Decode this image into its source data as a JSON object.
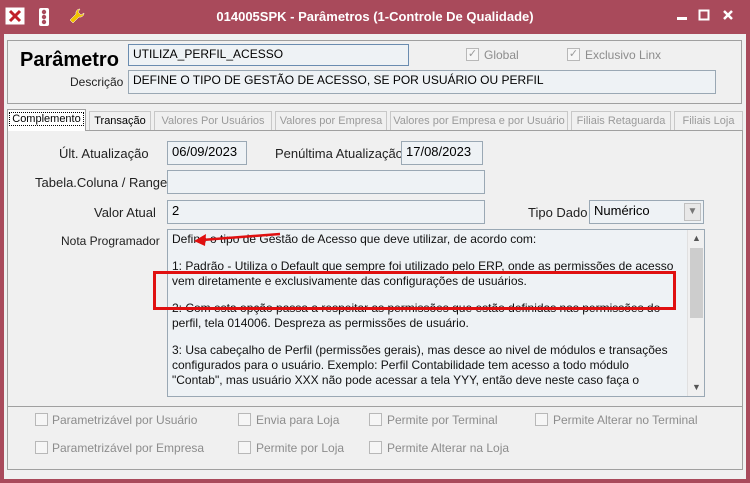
{
  "window": {
    "title": "014005SPK - Parâmetros (1-Controle De Qualidade)",
    "titlebar_color": "#a94a5b",
    "icons": [
      "close-red-icon",
      "traffic-light-icon",
      "wrench-icon"
    ],
    "controls": [
      "minimize-icon",
      "restore-icon",
      "close-icon"
    ]
  },
  "header": {
    "parametro_label": "Parâmetro",
    "parametro_value": "UTILIZA_PERFIL_ACESSO",
    "descricao_label": "Descrição",
    "descricao_value": "DEFINE O TIPO DE GESTÃO DE ACESSO, SE POR USUÁRIO OU PERFIL",
    "global_label": "Global",
    "global_checked": true,
    "exclusivo_label": "Exclusivo Linx",
    "exclusivo_checked": true
  },
  "tabs": [
    {
      "label": "Complemento",
      "state": "active"
    },
    {
      "label": "Transação",
      "state": "enabled"
    },
    {
      "label": "Valores Por Usuários",
      "state": "disabled"
    },
    {
      "label": "Valores por Empresa",
      "state": "disabled"
    },
    {
      "label": "Valores por Empresa e por Usuário",
      "state": "disabled"
    },
    {
      "label": "Filiais Retaguarda",
      "state": "disabled"
    },
    {
      "label": "Filiais Loja",
      "state": "disabled"
    }
  ],
  "form": {
    "ult_atualizacao_label": "Últ. Atualização",
    "ult_atualizacao_value": "06/09/2023",
    "penultima_label": "Penúltima Atualização",
    "penultima_value": "17/08/2023",
    "tabela_label": "Tabela.Coluna / Range",
    "tabela_value": "",
    "valor_atual_label": "Valor Atual",
    "valor_atual_value": "2",
    "tipo_dado_label": "Tipo Dado",
    "tipo_dado_value": "Numérico",
    "nota_label": "Nota Programador",
    "nota_paragraphs": [
      "Define o tipo de Gestão de Acesso que deve utilizar, de acordo com:",
      "1: Padrão - Utiliza o Default que sempre foi utilizado pelo ERP, onde as permissões de acesso vem diretamente e exclusivamente das configurações de usuários.",
      "2: Com esta opção passa a respeitar as permissões que estão definidas nas permissões do perfil, tela 014006. Despreza as permissões de usuário.",
      "3: Usa cabeçalho de Perfil (permissões gerais), mas desce ao nivel de módulos e transações configurados para o usuário. Exemplo: Perfil Contabilidade tem acesso a todo módulo \"Contab\", mas usuário XXX não pode acessar a tela YYY, então deve neste caso faça o"
    ]
  },
  "bottom_options": [
    "Parametrizável por Usuário",
    "Envia para Loja",
    "Permite por Terminal",
    "Permite Alterar no Terminal",
    "Parametrizável por Empresa",
    "Permite por Loja",
    "Permite Alterar na Loja"
  ],
  "annotation": {
    "color": "#e01010"
  }
}
